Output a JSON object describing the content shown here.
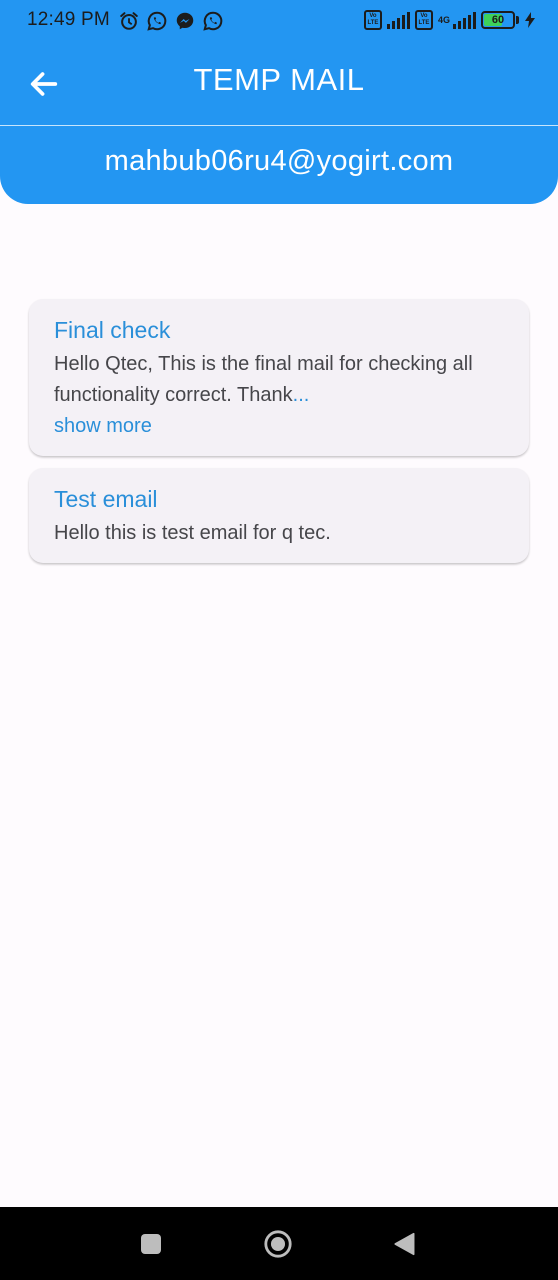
{
  "status_bar": {
    "time": "12:49 PM",
    "battery_level": "60",
    "network": "4G",
    "volte_label": "Vo LTE",
    "left_icons": [
      "alarm-icon",
      "whatsapp-icon",
      "messenger-icon",
      "whatsapp-icon"
    ]
  },
  "app_bar": {
    "title": "TEMP MAIL",
    "back_icon": "arrow-left-icon"
  },
  "account": {
    "email": "mahbub06ru4@yogirt.com"
  },
  "mails": [
    {
      "subject": "Final check",
      "body": "Hello Qtec, This is the final mail for checking all functionality correct. Thank",
      "ellipsis": "...",
      "show_more_label": "show more"
    },
    {
      "subject": "Test email",
      "body": "Hello this is test email for q tec."
    }
  ],
  "nav_bar": {
    "items": [
      "recents-square-icon",
      "home-circle-icon",
      "back-triangle-icon"
    ]
  },
  "colors": {
    "primary": "#2396f2",
    "accent_text": "#2a8fd9",
    "card_bg": "#f4f1f6",
    "page_bg": "#fefbfe"
  }
}
